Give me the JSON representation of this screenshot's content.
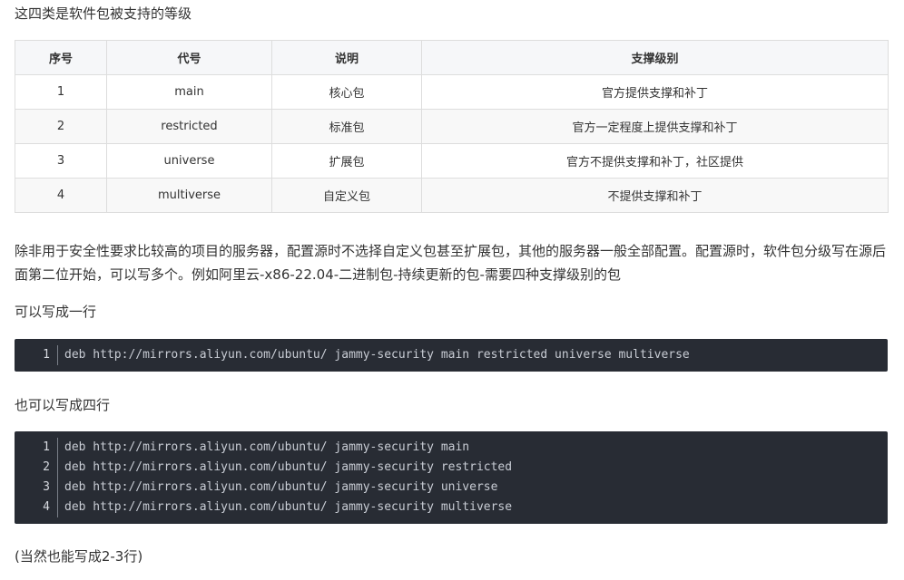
{
  "intro": "这四类是软件包被支持的等级",
  "table": {
    "headers": [
      "序号",
      "代号",
      "说明",
      "支撑级别"
    ],
    "rows": [
      [
        "1",
        "main",
        "核心包",
        "官方提供支撑和补丁"
      ],
      [
        "2",
        "restricted",
        "标准包",
        "官方一定程度上提供支撑和补丁"
      ],
      [
        "3",
        "universe",
        "扩展包",
        "官方不提供支撑和补丁，社区提供"
      ],
      [
        "4",
        "multiverse",
        "自定义包",
        "不提供支撑和补丁"
      ]
    ]
  },
  "description": "除非用于安全性要求比较高的项目的服务器，配置源时不选择自定义包甚至扩展包，其他的服务器一般全部配置。配置源时，软件包分级写在源后面第二位开始，可以写多个。例如阿里云-x86-22.04-二进制包-持续更新的包-需要四种支撑级别的包",
  "label_single": "可以写成一行",
  "code_single": [
    {
      "n": "1",
      "text": "deb http://mirrors.aliyun.com/ubuntu/ jammy-security main restricted universe multiverse"
    }
  ],
  "label_multi": "也可以写成四行",
  "code_multi": [
    {
      "n": "1",
      "text": "deb http://mirrors.aliyun.com/ubuntu/ jammy-security main"
    },
    {
      "n": "2",
      "text": "deb http://mirrors.aliyun.com/ubuntu/ jammy-security restricted"
    },
    {
      "n": "3",
      "text": "deb http://mirrors.aliyun.com/ubuntu/ jammy-security universe"
    },
    {
      "n": "4",
      "text": "deb http://mirrors.aliyun.com/ubuntu/ jammy-security multiverse"
    }
  ],
  "footer_note": "(当然也能写成2-3行)"
}
